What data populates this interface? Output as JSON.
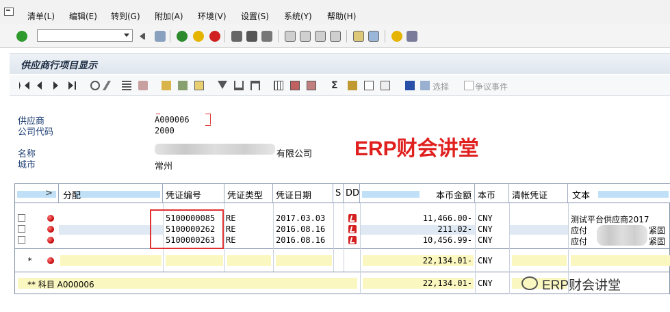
{
  "menu": {
    "items": [
      "清单(L)",
      "编辑(E)",
      "转到(G)",
      "附加(A)",
      "环境(V)",
      "设置(S)",
      "系统(Y)",
      "帮助(H)"
    ]
  },
  "toolbar": {
    "command_value": ""
  },
  "title": "供应商行项目显示",
  "app_toolbar": {
    "select_label": "选择",
    "dispute_label": "争议事件"
  },
  "header": {
    "vendor_label": "供应商",
    "vendor_value": "A000006",
    "company_label": "公司代码",
    "company_value": "2000",
    "name_label": "名称",
    "name_value_visible": "有限公司",
    "city_label": "城市",
    "city_value": "常州"
  },
  "watermark": "ERP财会讲堂",
  "grid": {
    "columns": [
      "分配",
      "凭证编号",
      "凭证类型",
      "凭证日期",
      "S",
      "DD",
      "本币金额",
      "本币",
      "清帐凭证",
      "文本"
    ],
    "rows": [
      {
        "doc_no": "5100000085",
        "type": "RE",
        "date": "2017.03.03",
        "amount": "11,466.00-",
        "currency": "CNY",
        "text": "测试平台供应商2017"
      },
      {
        "doc_no": "5100000262",
        "type": "RE",
        "date": "2016.08.16",
        "amount": "211.02-",
        "currency": "CNY",
        "text": "应付"
      },
      {
        "doc_no": "5100000263",
        "type": "RE",
        "date": "2016.08.16",
        "amount": "10,456.99-",
        "currency": "CNY",
        "text": "应付"
      }
    ],
    "row_text_tails": [
      "",
      "紧固",
      "紧固"
    ],
    "subtotal": {
      "marker": "*",
      "amount": "22,134.01-",
      "currency": "CNY"
    },
    "total": {
      "label": "** 科目 A000006",
      "amount": "22,134.01-",
      "currency": "CNY"
    }
  },
  "wechat_label": "ERP财会讲堂",
  "colors": {
    "watermark": "#e0201f",
    "header_bar": "#bfe0f6",
    "total_bar": "#fbf7c0",
    "highlight_box": "#e03030"
  }
}
